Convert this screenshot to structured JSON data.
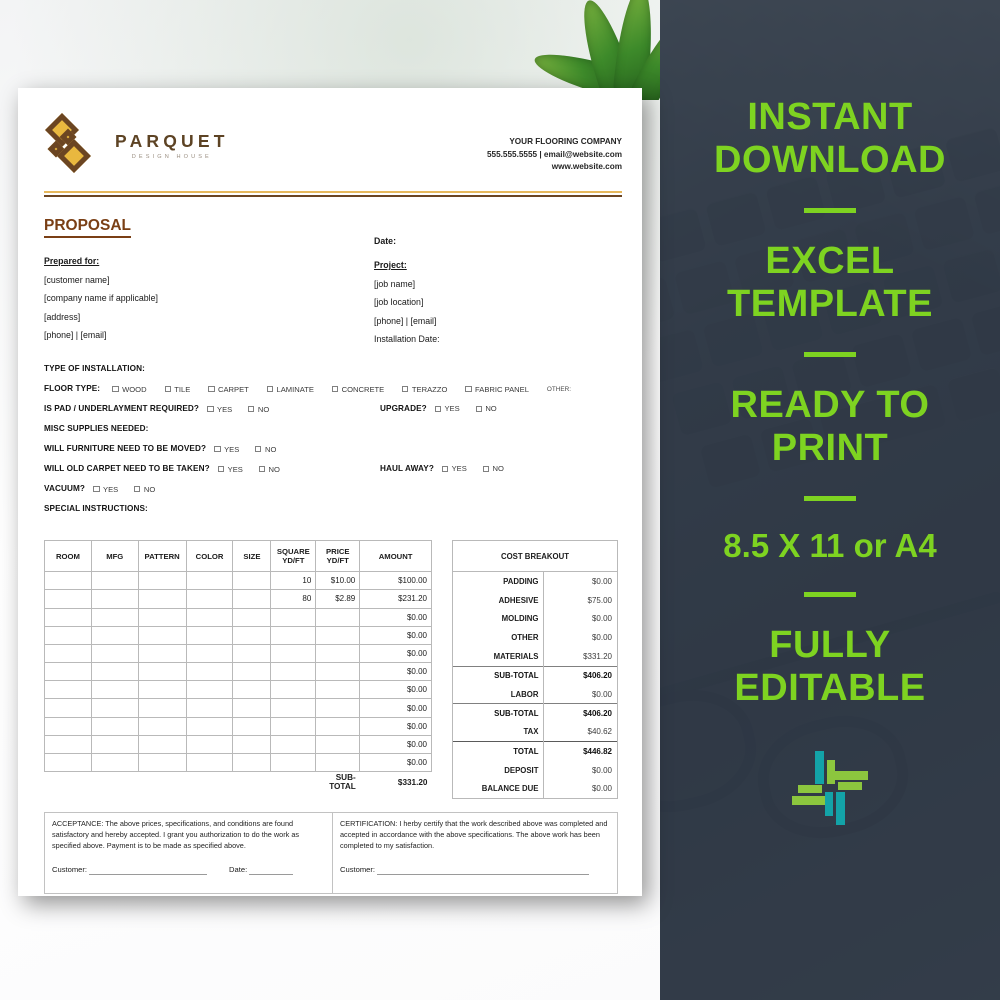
{
  "document": {
    "brand": {
      "name": "PARQUET",
      "tagline": "DESIGN HOUSE"
    },
    "contact": {
      "company": "YOUR FLOORING COMPANY",
      "phone_email": "555.555.5555  |  email@website.com",
      "website": "www.website.com"
    },
    "title": "PROPOSAL",
    "date_label": "Date:",
    "prepared_for": {
      "label": "Prepared for:",
      "lines": [
        "[customer name]",
        "[company name if applicable]",
        "[address]",
        "[phone]   |   [email]"
      ]
    },
    "project": {
      "label": "Project:",
      "lines": [
        "[job name]",
        "[job location]",
        "[phone]   |   [email]",
        "Installation Date:"
      ]
    },
    "install": {
      "type_label": "TYPE OF INSTALLATION:",
      "floor_type_label": "FLOOR TYPE:",
      "floor_types": [
        "WOOD",
        "TILE",
        "CARPET",
        "LAMINATE",
        "CONCRETE",
        "TERAZZO",
        "FABRIC PANEL"
      ],
      "other_label": "OTHER:",
      "pad_label": "IS PAD / UNDERLAYMENT REQUIRED?",
      "upgrade_label": "UPGRADE?",
      "misc_label": "MISC SUPPLIES NEEDED:",
      "furniture_label": "WILL FURNITURE NEED TO BE MOVED?",
      "old_carpet_label": "WILL OLD CARPET NEED TO BE TAKEN?",
      "haul_away_label": "HAUL AWAY?",
      "vacuum_label": "VACUUM?",
      "special_label": "SPECIAL INSTRUCTIONS:",
      "yes": "YES",
      "no": "NO"
    },
    "items_table": {
      "headers": [
        "ROOM",
        "MFG",
        "PATTERN",
        "COLOR",
        "SIZE",
        "SQUARE\nYD/FT",
        "PRICE\nYD/FT",
        "AMOUNT"
      ],
      "rows": [
        {
          "room": "",
          "mfg": "",
          "pattern": "",
          "color": "",
          "size": "",
          "square": "10",
          "price": "$10.00",
          "amount": "$100.00"
        },
        {
          "room": "",
          "mfg": "",
          "pattern": "",
          "color": "",
          "size": "",
          "square": "80",
          "price": "$2.89",
          "amount": "$231.20"
        },
        {
          "room": "",
          "mfg": "",
          "pattern": "",
          "color": "",
          "size": "",
          "square": "",
          "price": "",
          "amount": "$0.00"
        },
        {
          "room": "",
          "mfg": "",
          "pattern": "",
          "color": "",
          "size": "",
          "square": "",
          "price": "",
          "amount": "$0.00"
        },
        {
          "room": "",
          "mfg": "",
          "pattern": "",
          "color": "",
          "size": "",
          "square": "",
          "price": "",
          "amount": "$0.00"
        },
        {
          "room": "",
          "mfg": "",
          "pattern": "",
          "color": "",
          "size": "",
          "square": "",
          "price": "",
          "amount": "$0.00"
        },
        {
          "room": "",
          "mfg": "",
          "pattern": "",
          "color": "",
          "size": "",
          "square": "",
          "price": "",
          "amount": "$0.00"
        },
        {
          "room": "",
          "mfg": "",
          "pattern": "",
          "color": "",
          "size": "",
          "square": "",
          "price": "",
          "amount": "$0.00"
        },
        {
          "room": "",
          "mfg": "",
          "pattern": "",
          "color": "",
          "size": "",
          "square": "",
          "price": "",
          "amount": "$0.00"
        },
        {
          "room": "",
          "mfg": "",
          "pattern": "",
          "color": "",
          "size": "",
          "square": "",
          "price": "",
          "amount": "$0.00"
        },
        {
          "room": "",
          "mfg": "",
          "pattern": "",
          "color": "",
          "size": "",
          "square": "",
          "price": "",
          "amount": "$0.00"
        }
      ],
      "subtotal_label": "SUB-TOTAL",
      "subtotal_value": "$331.20"
    },
    "cost_breakout": {
      "header": "COST BREAKOUT",
      "rows": [
        {
          "label": "PADDING",
          "value": "$0.00"
        },
        {
          "label": "ADHESIVE",
          "value": "$75.00"
        },
        {
          "label": "MOLDING",
          "value": "$0.00"
        },
        {
          "label": "OTHER",
          "value": "$0.00"
        },
        {
          "label": "MATERIALS",
          "value": "$331.20"
        },
        {
          "label": "SUB-TOTAL",
          "value": "$406.20"
        },
        {
          "label": "LABOR",
          "value": "$0.00"
        },
        {
          "label": "SUB-TOTAL",
          "value": "$406.20"
        },
        {
          "label": "TAX",
          "value": "$40.62"
        },
        {
          "label": "TOTAL",
          "value": "$446.82"
        },
        {
          "label": "DEPOSIT",
          "value": "$0.00"
        },
        {
          "label": "BALANCE DUE",
          "value": "$0.00"
        }
      ]
    },
    "acceptance": {
      "text": "ACCEPTANCE: The above prices, specifications, and conditions are found satisfactory and hereby accepted. I grant you authorization to do the work as specified above. Payment is to be made as specified above.",
      "customer_label": "Customer:",
      "date_label": "Date:"
    },
    "certification": {
      "text": "CERTIFICATION: I herby certify that the work described above was completed and accepted in accordance with the above specifications. The above work has been completed to my satisfaction.",
      "customer_label": "Customer:"
    }
  },
  "promo_panel": {
    "accent_color": "#7ed321",
    "background_color": "#39424f",
    "blocks": [
      "INSTANT\nDOWNLOAD",
      "EXCEL\nTEMPLATE",
      "READY TO\nPRINT",
      "8.5 X 11 or A4",
      "FULLY\nEDITABLE"
    ],
    "logo_colors": {
      "teal": "#13a3a8",
      "green": "#8cc63e"
    }
  }
}
